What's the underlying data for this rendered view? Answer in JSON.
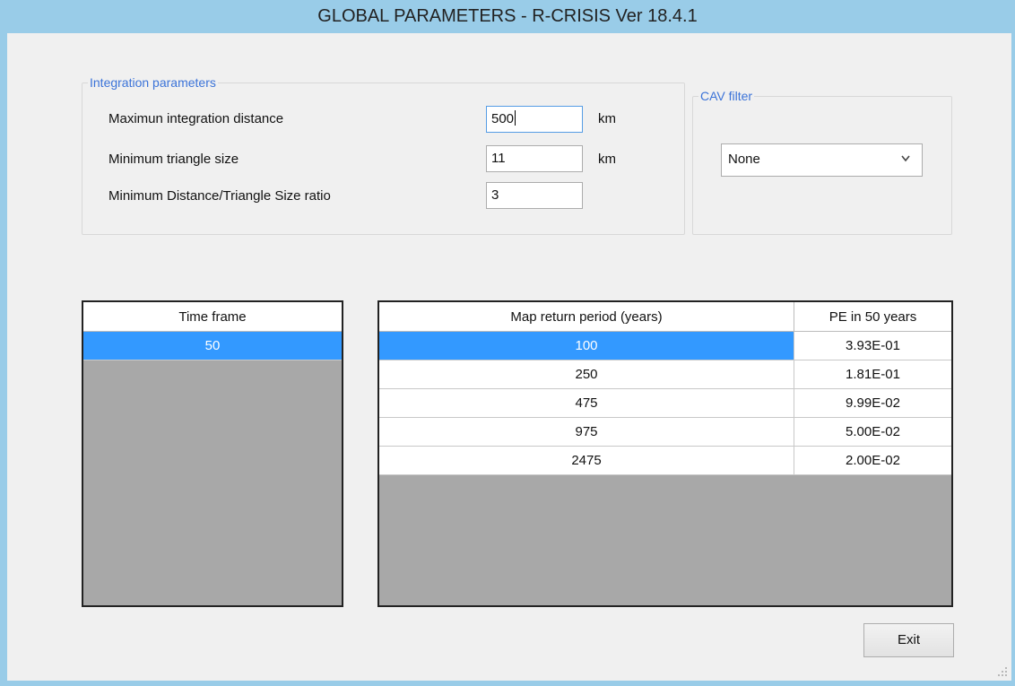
{
  "window": {
    "title": "GLOBAL PARAMETERS - R-CRISIS Ver 18.4.1"
  },
  "integration": {
    "legend": "Integration parameters",
    "max_distance": {
      "label": "Maximun integration distance",
      "value": "500",
      "unit": "km"
    },
    "min_triangle": {
      "label": "Minimum triangle size",
      "value": "11",
      "unit": "km"
    },
    "ratio": {
      "label": "Minimum Distance/Triangle Size ratio",
      "value": "3"
    }
  },
  "cav": {
    "legend": "CAV filter",
    "selected": "None"
  },
  "time_frame": {
    "header": "Time frame",
    "rows": [
      "50"
    ],
    "selected_index": 0
  },
  "return_periods": {
    "headers": [
      "Map return period (years)",
      "PE in 50 years"
    ],
    "rows": [
      [
        "100",
        "3.93E-01"
      ],
      [
        "250",
        "1.81E-01"
      ],
      [
        "475",
        "9.99E-02"
      ],
      [
        "975",
        "5.00E-02"
      ],
      [
        "2475",
        "2.00E-02"
      ]
    ],
    "selected_index": 0
  },
  "buttons": {
    "exit": "Exit"
  }
}
